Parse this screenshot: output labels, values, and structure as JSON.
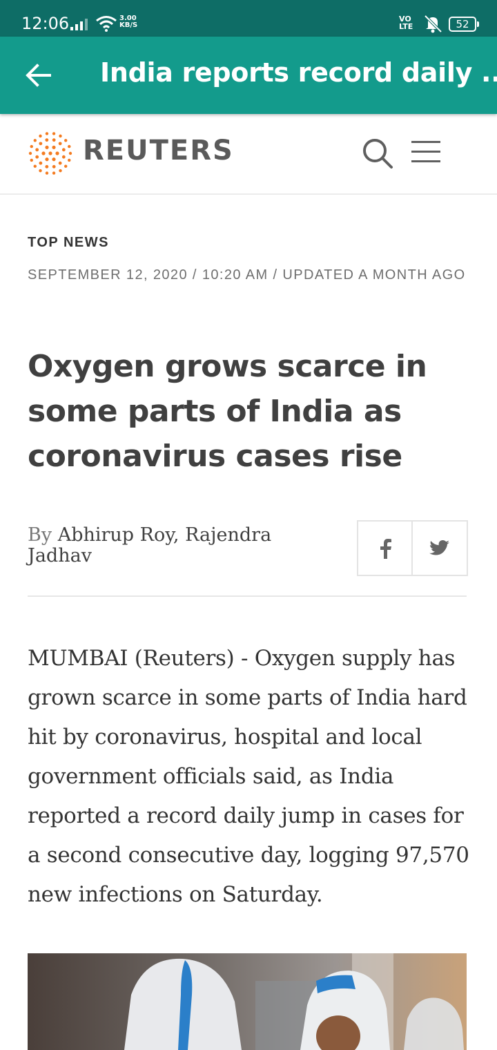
{
  "status_bar": {
    "time": "12:06",
    "net_speed_value": "3.00",
    "net_speed_unit": "KB/S",
    "volte_top": "VO",
    "volte_bottom": "LTE",
    "battery": "52"
  },
  "app_bar": {
    "title": "India reports record daily ..."
  },
  "site": {
    "brand": "REUTERS",
    "brand_color": "#f47b20"
  },
  "article": {
    "section": "TOP NEWS",
    "dateline": "SEPTEMBER 12, 2020 / 10:20 AM / UPDATED A MONTH AGO",
    "headline": "Oxygen grows scarce in some parts of India as coronavirus cases rise",
    "byline_prefix": "By",
    "authors": "Abhirup Roy, Rajendra Jadhav",
    "body": "MUMBAI (Reuters) - Oxygen supply has grown scarce in some parts of India hard hit by coronavirus, hospital and local government officials said, as India reported a record daily jump in cases for a second consecutive day, logging 97,570 new infections on Saturday."
  },
  "share": {
    "facebook_icon": "facebook-icon",
    "twitter_icon": "twitter-icon"
  },
  "colors": {
    "status_bar": "#0e6d66",
    "app_bar": "#139b8c",
    "text": "#404040",
    "meta": "#6e6e6e"
  }
}
